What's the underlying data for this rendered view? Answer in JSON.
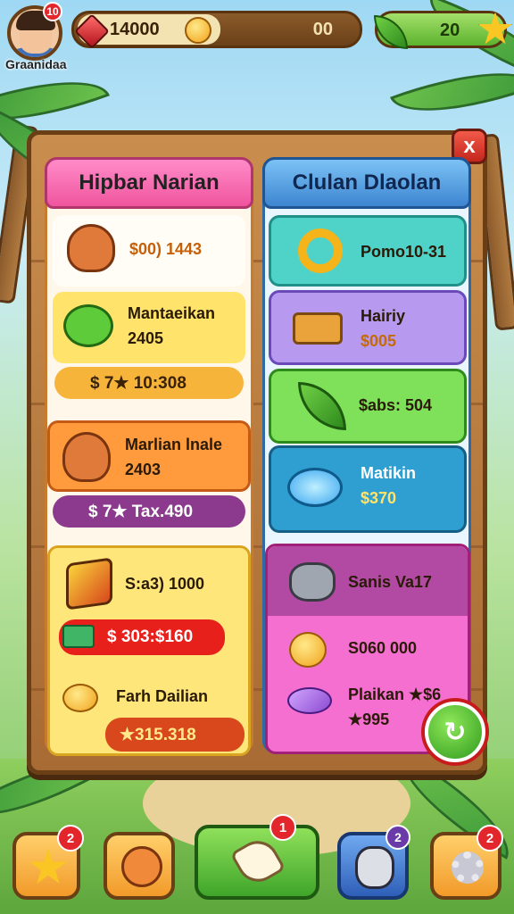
{
  "hud": {
    "player_name": "Graanidaa",
    "avatar_badge": "10",
    "coins": "14000",
    "gems": "00",
    "energy": "20"
  },
  "panel": {
    "close_label": "x",
    "left_tab": "Hipbar Narian",
    "right_tab": "Clulan Dlaolan",
    "left_items": [
      {
        "price": "$00) 1443",
        "icon": "fox-icon"
      },
      {
        "label": "Mantaeikan",
        "sub": "2405",
        "icon": "turtle-icon"
      },
      {
        "pill": "$ 7★ 10:308"
      },
      {
        "label": "Marlian lnale",
        "sub": "2403",
        "icon": "fox-icon"
      },
      {
        "pill": "$ 7★ Tax.490"
      },
      {
        "price": "S:a3) 1000",
        "icon": "book-icon"
      },
      {
        "pill": "$ 303:$160",
        "icon": "cash-icon"
      },
      {
        "label": "Farh Dailian",
        "icon": "coins-icon"
      },
      {
        "pill": "★315.318"
      }
    ],
    "right_items": [
      {
        "label": "Pomo10-31",
        "icon": "pretzel-icon"
      },
      {
        "label": "Hairiy",
        "sub": "$005",
        "icon": "bread-icon"
      },
      {
        "label": "$abs: 504",
        "icon": "leaf-icon"
      },
      {
        "label": "Matikin",
        "sub": "$370",
        "icon": "water-icon"
      },
      {
        "label": "Sanis Va17",
        "icon": "pot-icon"
      },
      {
        "label": "S060 000",
        "icon": "coins-icon"
      },
      {
        "label": "Plaikan ★$6",
        "sub": "★995",
        "icon": "gem-icon"
      }
    ],
    "refresh_label": "refresh"
  },
  "bottom_bar": {
    "star_badge": "2",
    "pet_badge": "",
    "main_badge": "1",
    "char_badge": "2",
    "settings_badge": "2"
  },
  "colors": {
    "left_tab": "#f0559e",
    "right_tab": "#3d85d0",
    "badge": "#e3262c"
  }
}
